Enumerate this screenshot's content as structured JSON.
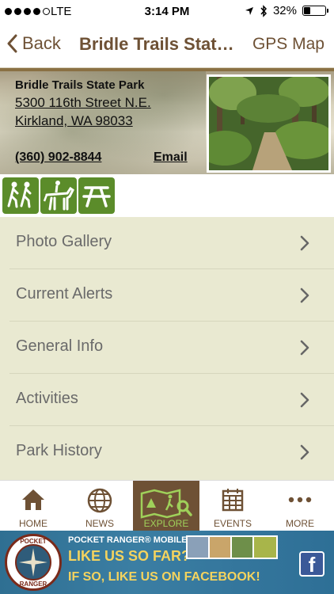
{
  "status_bar": {
    "carrier": "LTE",
    "time": "3:14 PM",
    "battery_percent_label": "32%",
    "battery_level": 0.32,
    "signal_bars_filled": 4,
    "signal_bars_total": 5
  },
  "nav": {
    "back_label": "Back",
    "title": "Bridle Trails State Park",
    "gps_label": "GPS Map"
  },
  "park": {
    "name": "Bridle Trails State Park",
    "address_line1": "5300 116th Street N.E.",
    "address_line2": "Kirkland, WA 98033",
    "phone": "(360) 902-8844",
    "email_label": "Email"
  },
  "activities": [
    {
      "icon": "hiking-icon"
    },
    {
      "icon": "horseback-riding-icon"
    },
    {
      "icon": "picnic-table-icon"
    }
  ],
  "menu": [
    {
      "label": "Photo Gallery"
    },
    {
      "label": "Current Alerts"
    },
    {
      "label": "General Info"
    },
    {
      "label": "Activities"
    },
    {
      "label": "Park History"
    }
  ],
  "tabs": [
    {
      "label": "HOME",
      "icon": "home-icon",
      "active": false
    },
    {
      "label": "NEWS",
      "icon": "globe-icon",
      "active": false
    },
    {
      "label": "EXPLORE",
      "icon": "explore-map-icon",
      "active": true
    },
    {
      "label": "EVENTS",
      "icon": "calendar-icon",
      "active": false
    },
    {
      "label": "MORE",
      "icon": "more-dots-icon",
      "active": false
    }
  ],
  "ad": {
    "logo_top": "POCKET",
    "logo_bottom": "RANGER",
    "app_line": "POCKET RANGER® MOBILE APP",
    "line1": "LIKE US SO FAR?",
    "line2": "IF SO, LIKE US ON FACEBOOK!"
  },
  "colors": {
    "brand_brown": "#6e5135",
    "activity_green": "#5b8c2a",
    "menu_bg": "#e9e9d1",
    "active_tab_label": "#9fd05a"
  }
}
